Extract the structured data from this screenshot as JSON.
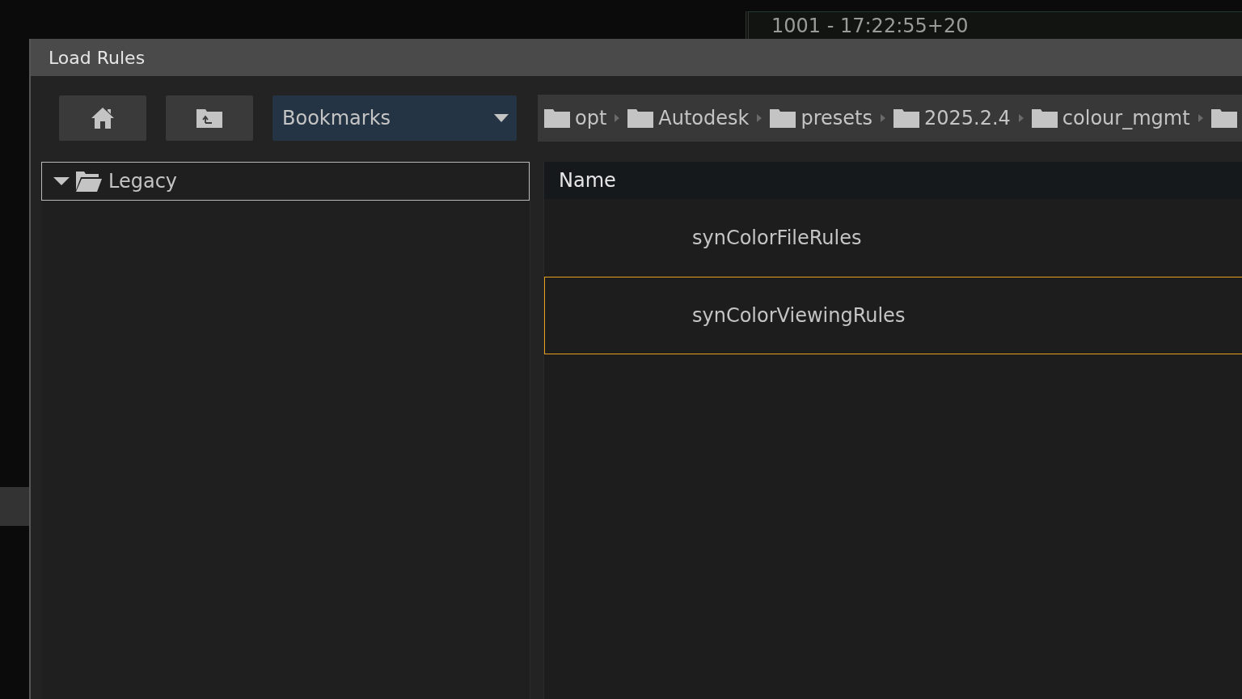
{
  "timecode": "1001 - 17:22:55+20",
  "window": {
    "title": "Load Rules"
  },
  "toolbar": {
    "bookmarks": {
      "value": "Bookmarks"
    }
  },
  "breadcrumb": [
    {
      "label": "opt"
    },
    {
      "label": "Autodesk"
    },
    {
      "label": "presets"
    },
    {
      "label": "2025.2.4"
    },
    {
      "label": "colour_mgmt"
    }
  ],
  "tree": [
    {
      "label": "Legacy",
      "expanded": true,
      "selected": true
    }
  ],
  "file_list": {
    "columns": [
      "Name"
    ],
    "rows": [
      {
        "name": "synColorFileRules",
        "selected": false
      },
      {
        "name": "synColorViewingRules",
        "selected": true
      }
    ]
  }
}
